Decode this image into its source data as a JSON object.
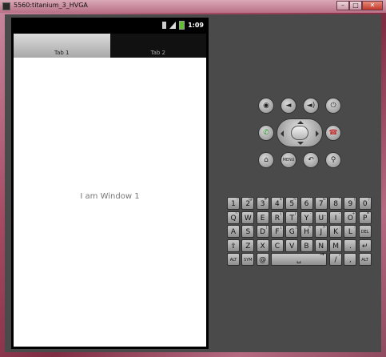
{
  "window": {
    "title": "5560:titanium_3_HVGA",
    "buttons": {
      "min": "–",
      "max": "□",
      "close": "✕"
    }
  },
  "status_bar": {
    "time": "1:09"
  },
  "tabs": [
    {
      "label": "Tab 1",
      "active": true
    },
    {
      "label": "Tab 2",
      "active": false
    }
  ],
  "content": {
    "message": "I am Window 1"
  },
  "controls": {
    "row1": [
      "camera-icon",
      "volume-down-icon",
      "volume-up-icon",
      "power-icon"
    ],
    "row2": [
      "call-icon",
      "dpad",
      "end-call-icon"
    ],
    "row3": [
      "home-icon",
      "MENU",
      "back-icon",
      "search-icon"
    ]
  },
  "keyboard": {
    "row1": [
      [
        "1",
        "!"
      ],
      [
        "2",
        "@"
      ],
      [
        "3",
        "#"
      ],
      [
        "4",
        "$"
      ],
      [
        "5",
        "%"
      ],
      [
        "6",
        "^"
      ],
      [
        "7",
        "&"
      ],
      [
        "8",
        "*"
      ],
      [
        "9",
        "("
      ],
      [
        "0",
        ")"
      ]
    ],
    "row2": [
      [
        "Q",
        "~"
      ],
      [
        "W",
        "\""
      ],
      [
        "E",
        "`"
      ],
      [
        "R",
        "{"
      ],
      [
        "T",
        "}"
      ],
      [
        "Y",
        "-"
      ],
      [
        "U",
        "_"
      ],
      [
        "I",
        "–"
      ],
      [
        "O",
        "+"
      ],
      [
        "P",
        "="
      ]
    ],
    "row3": [
      [
        "A",
        ""
      ],
      [
        "S",
        "\\"
      ],
      [
        "D",
        "|"
      ],
      [
        "F",
        "["
      ],
      [
        "G",
        "]"
      ],
      [
        "H",
        "<"
      ],
      [
        "J",
        ">"
      ],
      [
        "K",
        ";"
      ],
      [
        "L",
        ":"
      ],
      [
        "DEL",
        ""
      ]
    ],
    "row4": [
      [
        "⇧",
        ""
      ],
      [
        "Z",
        ""
      ],
      [
        "X",
        ""
      ],
      [
        "C",
        ""
      ],
      [
        "V",
        ""
      ],
      [
        "B",
        ""
      ],
      [
        "N",
        ""
      ],
      [
        "M",
        ""
      ],
      [
        ".",
        ""
      ],
      [
        "↵",
        ""
      ]
    ],
    "row5": [
      [
        "ALT",
        ""
      ],
      [
        "SYM",
        ""
      ],
      [
        "@",
        ""
      ],
      [
        "␣",
        ""
      ],
      [
        "→",
        ""
      ],
      [
        "/",
        "?"
      ],
      [
        ",",
        ""
      ],
      [
        "ALT",
        ""
      ]
    ]
  },
  "colors": {
    "call": "#2e9b2e",
    "end_call": "#c03030",
    "battery": "#5fbf2f"
  }
}
